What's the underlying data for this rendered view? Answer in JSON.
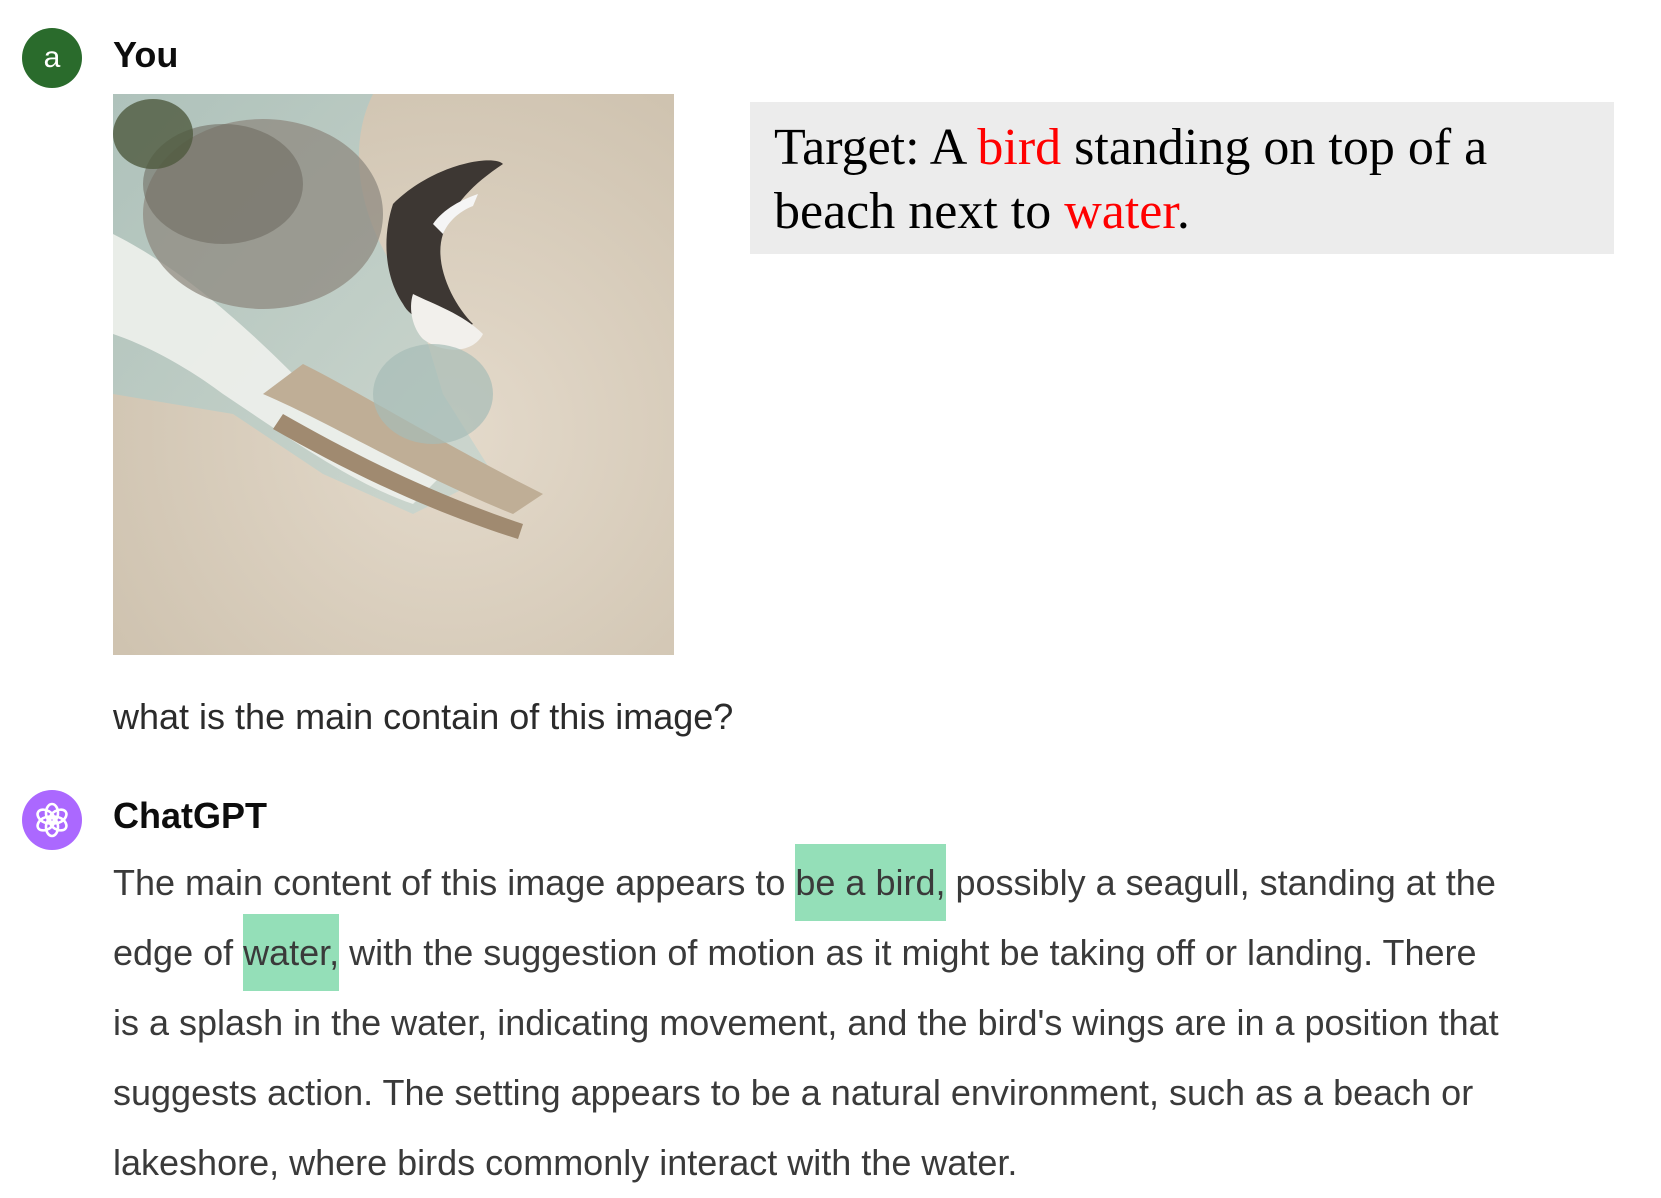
{
  "user": {
    "avatar_letter": "a",
    "avatar_color": "#2a6b2c",
    "name": "You",
    "prompt": "what is the main contain of this image?"
  },
  "target": {
    "prefix": "Target: A ",
    "word1": "bird",
    "middle1": " standing on top of a",
    "line2_prefix": "beach next to ",
    "word2": "water",
    "suffix": ".",
    "highlight_color": "#ff0000"
  },
  "assistant": {
    "name": "ChatGPT",
    "avatar_color": "#ab68ff",
    "highlight_color": "#94dfb8",
    "line1_a": "The main content of this image appears to ",
    "line1_hl": "be a bird,",
    "line1_b": " possibly a seagull, standing at the",
    "line2_a": "edge of ",
    "line2_hl": "water,",
    "line2_b": " with the suggestion of motion as it might be taking off or landing. There",
    "line3": "is a splash in the water, indicating movement, and the bird's wings are in a position that",
    "line4": "suggests action. The setting appears to be a natural environment, such as a beach or",
    "line5": "lakeshore, where birds commonly interact with the water."
  }
}
